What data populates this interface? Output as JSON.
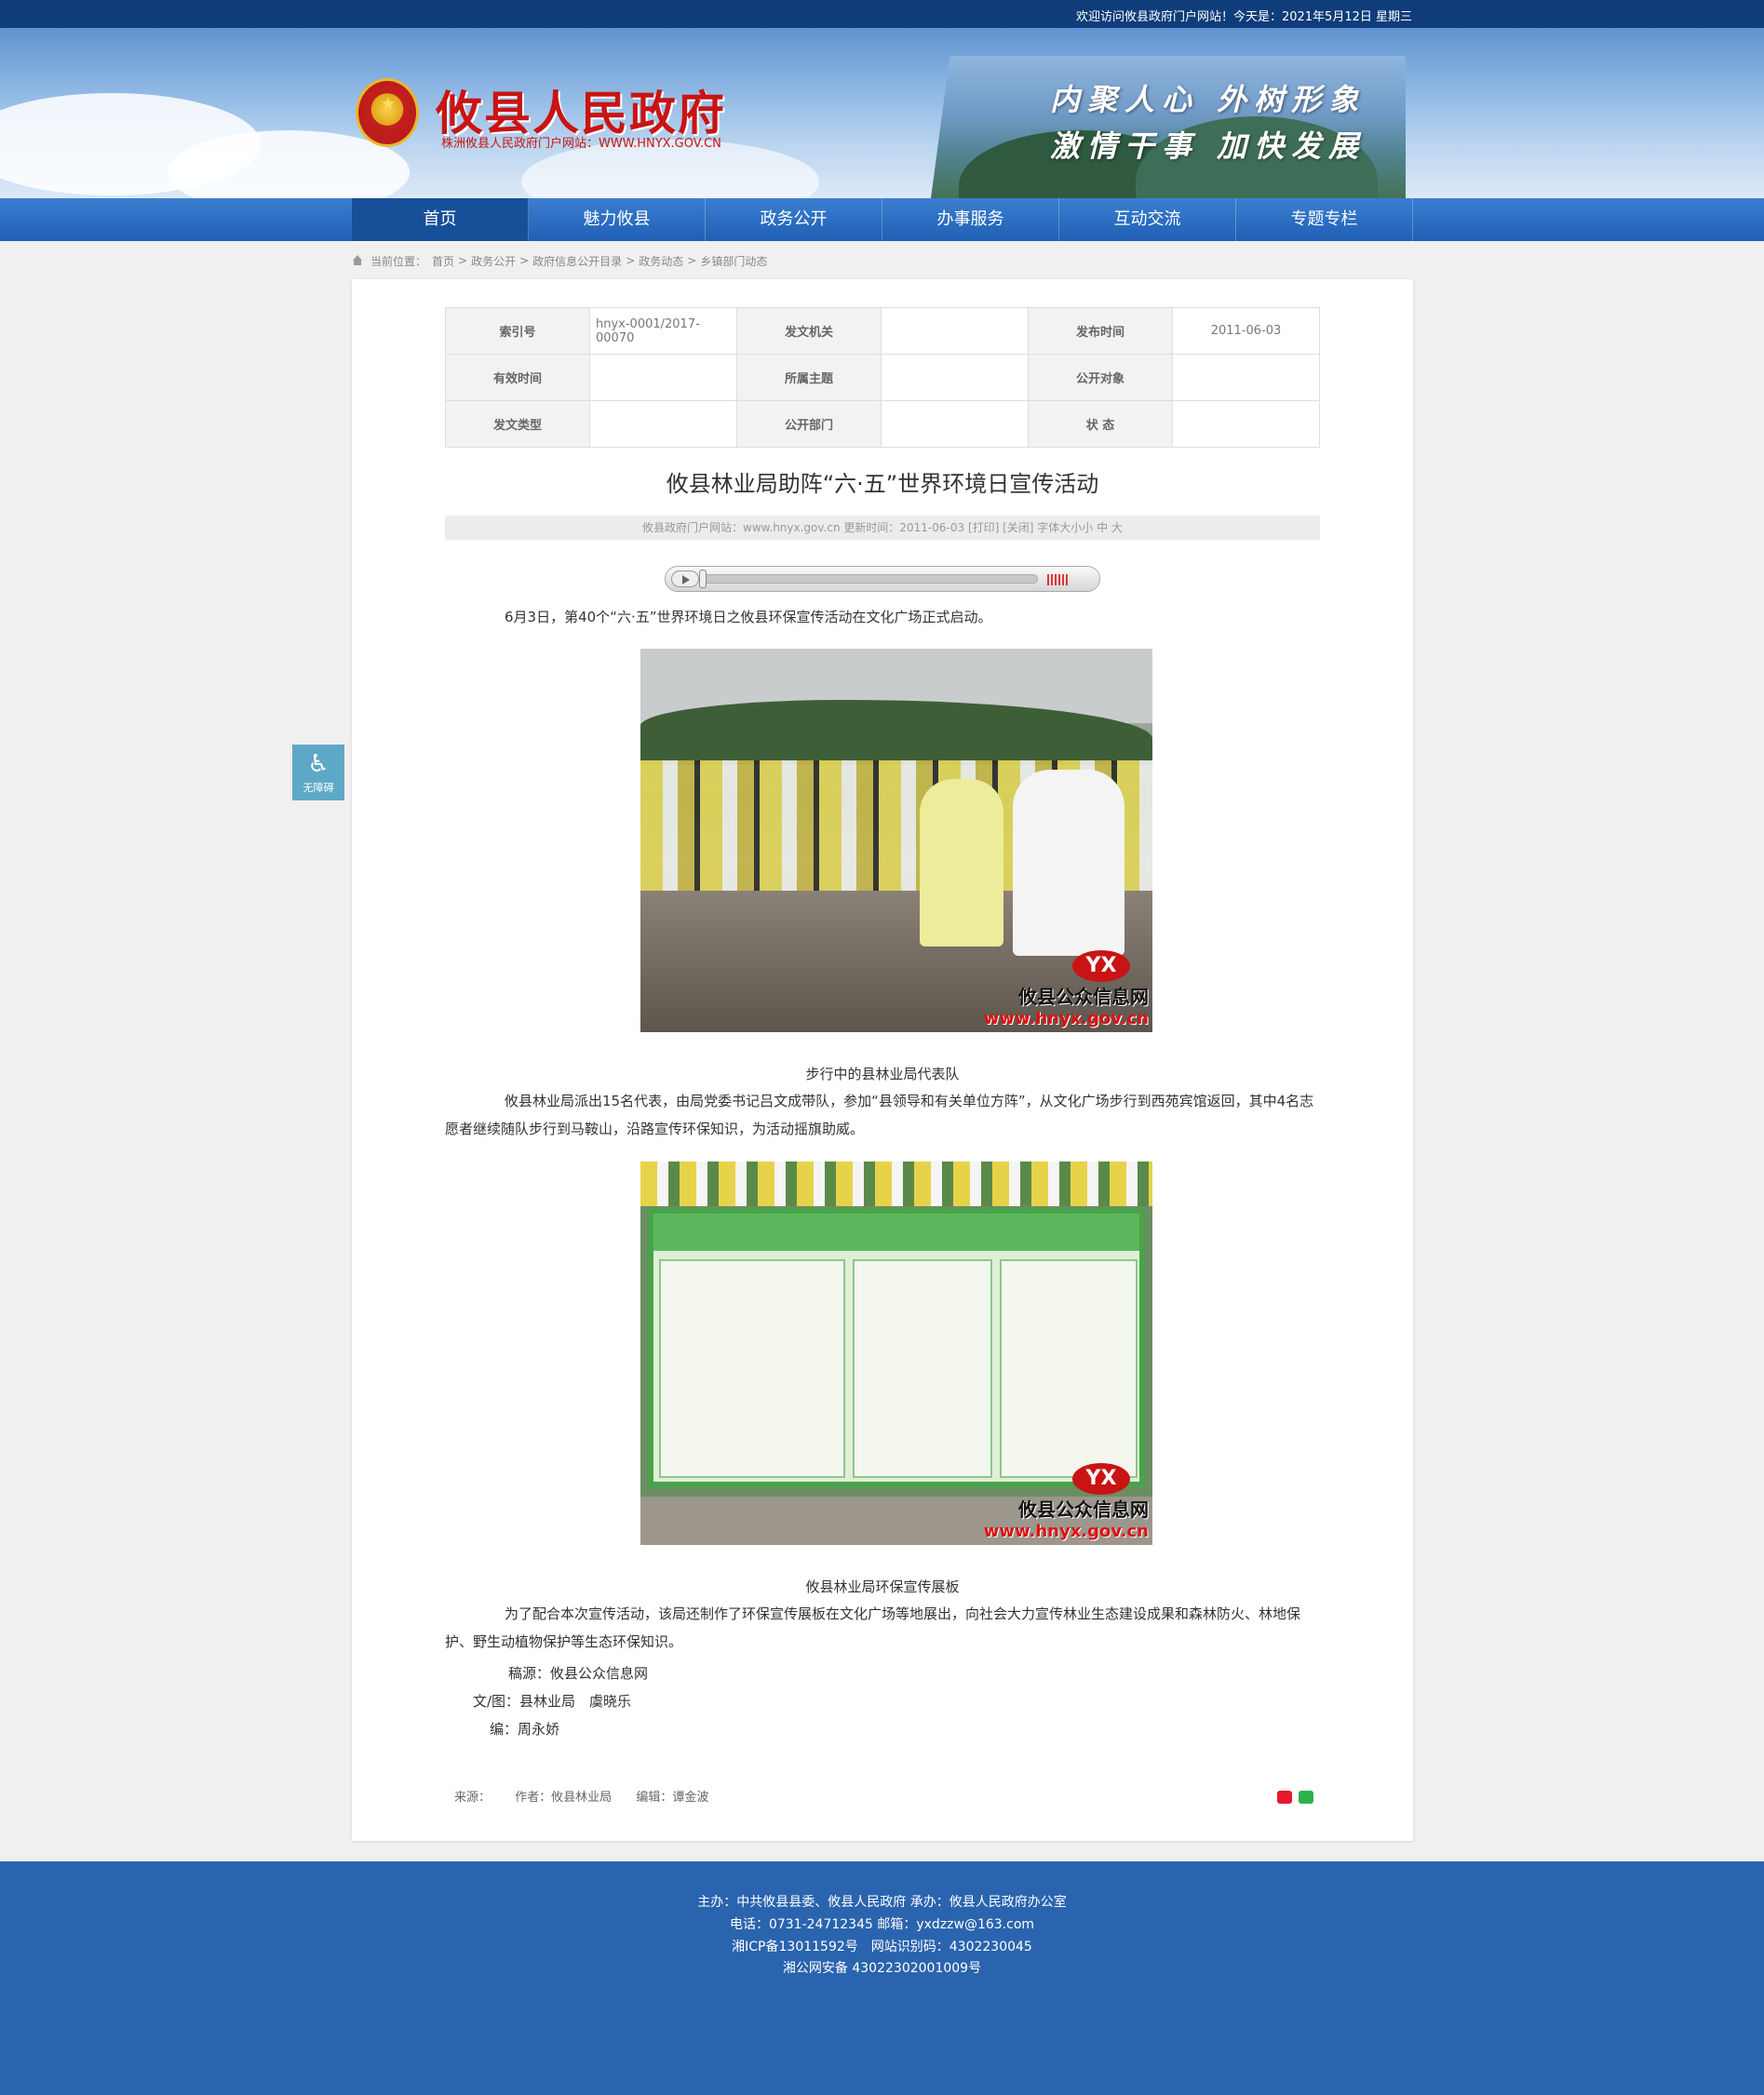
{
  "topbar": {
    "welcome": "欢迎访问攸县政府门户网站！今天是：2021年5月12日 星期三"
  },
  "header": {
    "site_title": "攸县人民政府",
    "site_subtitle": "株洲攸县人民政府门户网站：WWW.HNYX.GOV.CN",
    "slogan_line1": "内聚人心 外树形象",
    "slogan_line2": "激情干事 加快发展"
  },
  "nav": {
    "items": [
      {
        "label": "首页",
        "active": true
      },
      {
        "label": "魅力攸县"
      },
      {
        "label": "政务公开"
      },
      {
        "label": "办事服务"
      },
      {
        "label": "互动交流"
      },
      {
        "label": "专题专栏"
      }
    ]
  },
  "breadcrumb": {
    "prefix": "当前位置：",
    "items": [
      "首页",
      "政务公开",
      "政府信息公开目录",
      "政务动态",
      "乡镇部门动态"
    ],
    "separator": ">"
  },
  "meta_table": {
    "rows": [
      [
        {
          "k": "索引号",
          "v": "hnyx-0001/2017-00070"
        },
        {
          "k": "发文机关",
          "v": ""
        },
        {
          "k": "发布时间",
          "v": "2011-06-03"
        }
      ],
      [
        {
          "k": "有效时间",
          "v": ""
        },
        {
          "k": "所属主题",
          "v": ""
        },
        {
          "k": "公开对象",
          "v": ""
        }
      ],
      [
        {
          "k": "发文类型",
          "v": ""
        },
        {
          "k": "公开部门",
          "v": ""
        },
        {
          "k": "状 态",
          "v": ""
        }
      ]
    ]
  },
  "article": {
    "title": "攸县林业局助阵“六·五”世界环境日宣传活动",
    "info": "攸县政府门户网站：www.hnyx.gov.cn  更新时间：2011-06-03  [打印] [关闭]  字体大小小 中 大",
    "para1": "6月3日，第40个“六·五”世界环境日之攸县环保宣传活动在文化广场正式启动。",
    "caption1": "步行中的县林业局代表队",
    "para2": "攸县林业局派出15名代表，由局党委书记吕文成带队，参加“县领导和有关单位方阵”，从文化广场步行到西苑宾馆返回，其中4名志愿者继续随队步行到马鞍山，沿路宣传环保知识，为活动摇旗助威。",
    "caption2": "攸县林业局环保宣传展板",
    "para3": "为了配合本次宣传活动，该局还制作了环保宣传展板在文化广场等地展出，向社会大力宣传林业生态建设成果和森林防火、林地保护、野生动植物保护等生态环保知识。",
    "source_line": "稿源：攸县公众信息网",
    "author_line": "文/图：县林业局　虞晓乐",
    "editor_line": "编：周永娇",
    "watermark_logo": "YX",
    "watermark_name": "攸县公众信息网",
    "watermark_url": "www.hnyx.gov.cn"
  },
  "article_footer": {
    "source": "来源：",
    "author": "作者：攸县林业局",
    "editor": "编辑：谭金波",
    "share_icons": [
      "weibo-icon",
      "wechat-icon"
    ]
  },
  "accessibility": {
    "label": "无障碍",
    "icon": "wheelchair-icon"
  },
  "footer": {
    "line1": "主办：中共攸县县委、攸县人民政府 承办：攸县人民政府办公室",
    "line2": "电话：0731-24712345 邮箱：yxdzzw@163.com",
    "line3": "湘ICP备13011592号　网站识别码：4302230045",
    "line4": "湘公网安备 43022302001009号"
  },
  "colors": {
    "topbar": "#0f3d7a",
    "nav": "#1f5fb4",
    "nav_active": "#174f99",
    "title_red": "#c81414",
    "footer": "#2a64ae"
  }
}
